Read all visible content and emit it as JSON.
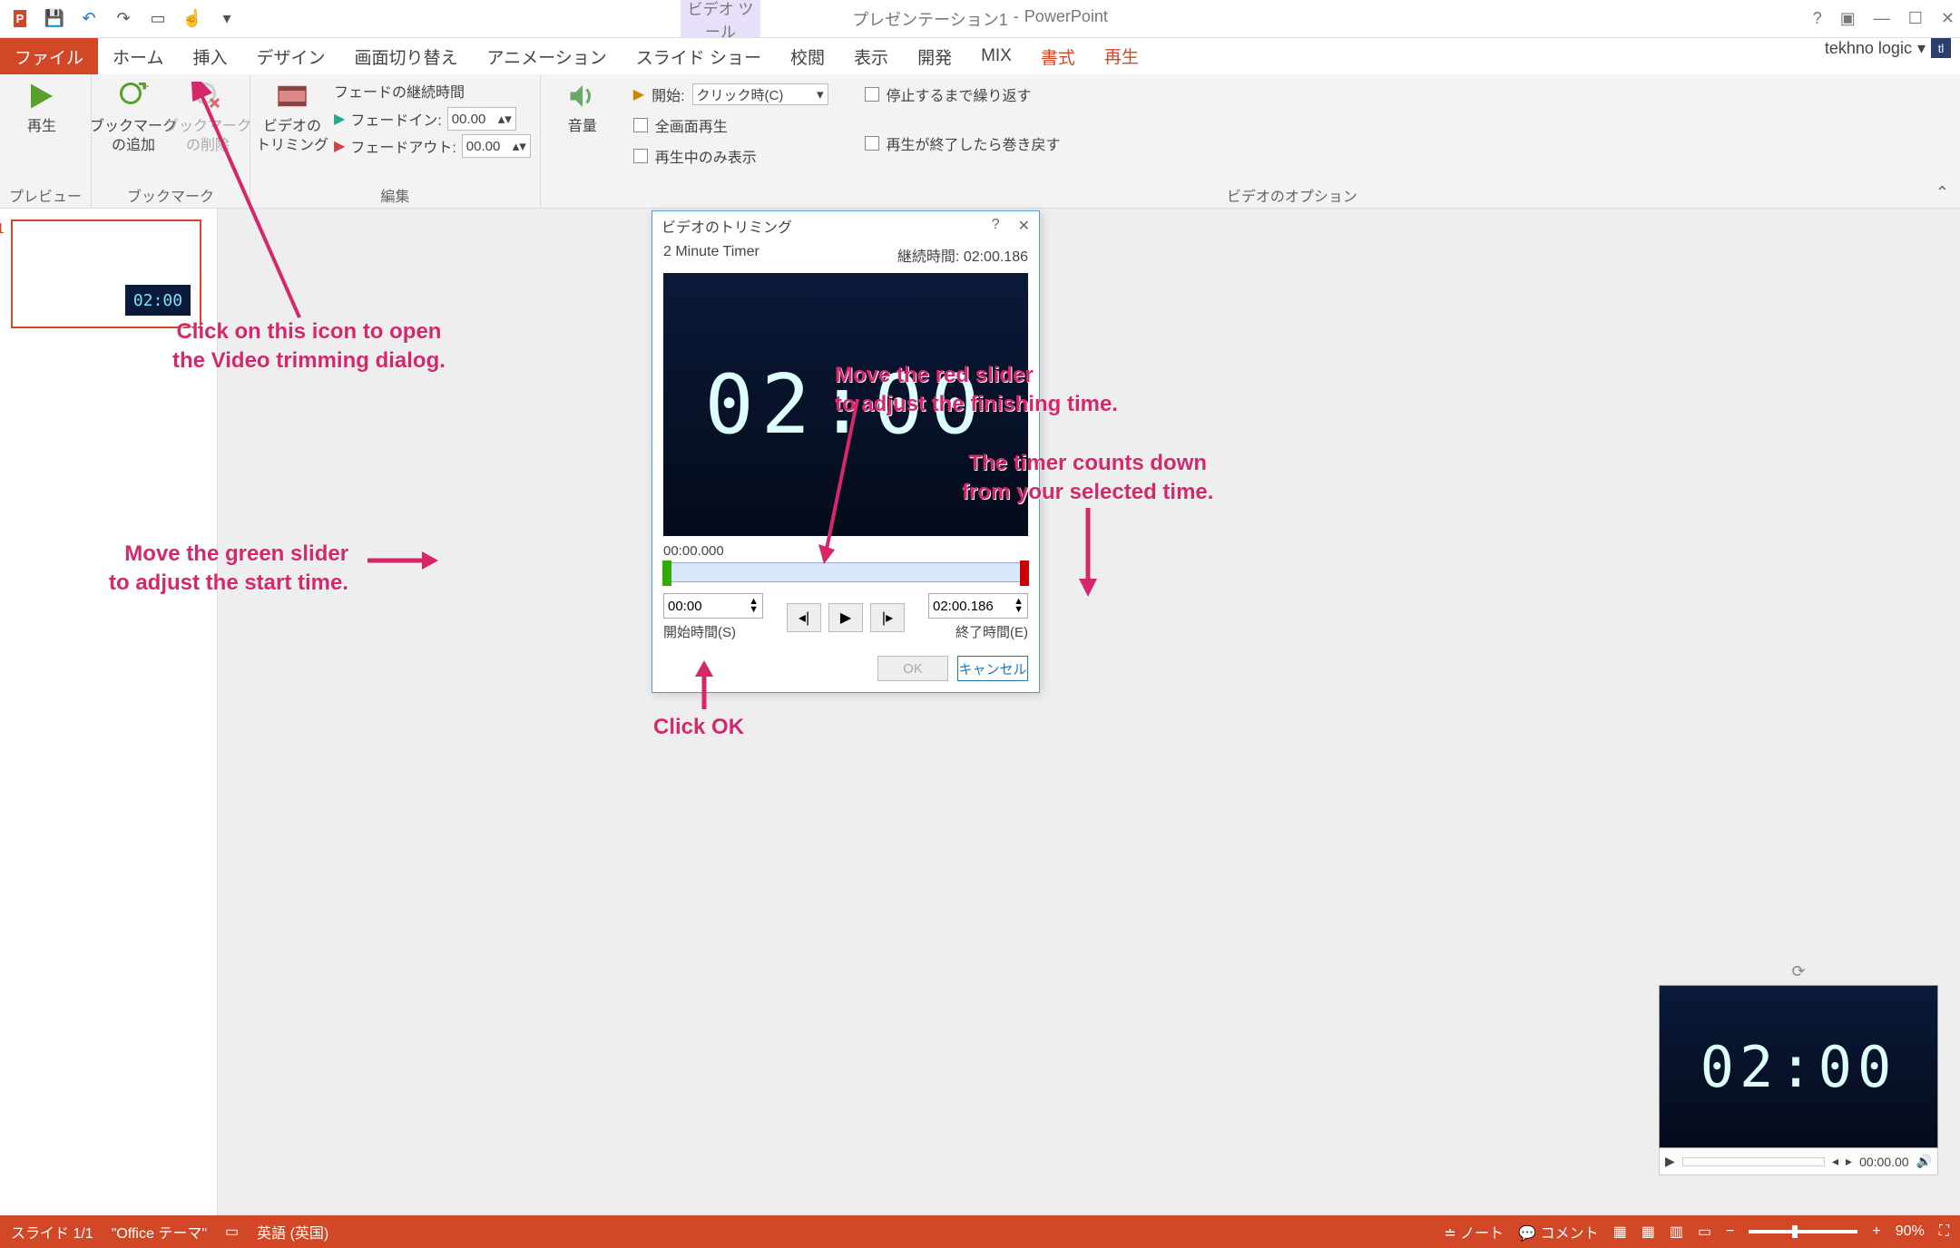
{
  "titlebar": {
    "doc_title": "プレゼンテーション1",
    "app_name": "PowerPoint",
    "context_tab_group": "ビデオ ツール"
  },
  "tabs": {
    "file": "ファイル",
    "home": "ホーム",
    "insert": "挿入",
    "design": "デザイン",
    "transitions": "画面切り替え",
    "animations": "アニメーション",
    "slideshow": "スライド ショー",
    "review": "校閲",
    "view": "表示",
    "developer": "開発",
    "mix": "MIX",
    "format": "書式",
    "playback": "再生"
  },
  "account": {
    "name": "tekhno logic"
  },
  "ribbon": {
    "preview": {
      "play": "再生",
      "group": "プレビュー"
    },
    "bookmark": {
      "add": "ブックマーク\nの追加",
      "remove": "ブックマーク\nの削除",
      "group": "ブックマーク"
    },
    "edit": {
      "trim": "ビデオの\nトリミング",
      "fade_title": "フェードの継続時間",
      "fade_in": "フェードイン:",
      "fade_in_val": "00.00",
      "fade_out": "フェードアウト:",
      "fade_out_val": "00.00",
      "group": "編集"
    },
    "volume": {
      "label": "音量"
    },
    "options": {
      "start_label": "開始:",
      "start_value": "クリック時(C)",
      "fullscreen": "全画面再生",
      "hide": "再生中のみ表示",
      "loop": "停止するまで繰り返す",
      "rewind": "再生が終了したら巻き戻す",
      "group": "ビデオのオプション"
    }
  },
  "thumb": {
    "num": "1",
    "time": "02:00"
  },
  "dialog": {
    "title": "ビデオのトリミング",
    "video_name": "2 Minute Timer",
    "duration_label": "継続時間:",
    "duration_value": "02:00.186",
    "preview_text": "02:00",
    "current_time": "00:00.000",
    "start_value": "00:00",
    "start_label": "開始時間(S)",
    "end_value": "02:00.186",
    "end_label": "終了時間(E)",
    "ok": "OK",
    "cancel": "キャンセル"
  },
  "slide_video": {
    "display": "02:00",
    "media_time": "00:00.00"
  },
  "annotations": {
    "trim_icon": "Click on this icon to open\nthe Video trimming dialog.",
    "green": "Move the green slider\nto adjust the start time.",
    "red": "Move the red slider\nto adjust the finishing time.",
    "timer": "The timer counts down\nfrom your selected time.",
    "ok": "Click OK"
  },
  "status": {
    "slide": "スライド 1/1",
    "theme": "\"Office テーマ\"",
    "lang": "英語 (英国)",
    "notes": "ノート",
    "comments": "コメント",
    "zoom": "90%"
  }
}
